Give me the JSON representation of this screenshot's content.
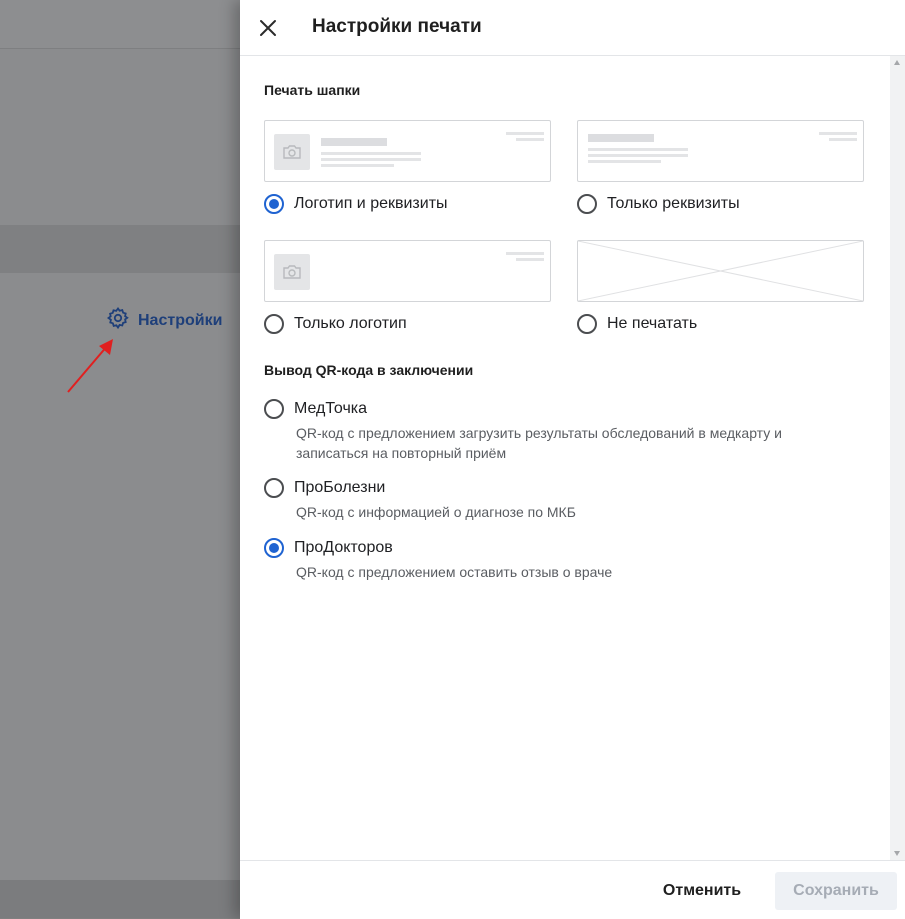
{
  "background": {
    "settings_label": "Настройки"
  },
  "drawer": {
    "title": "Настройки печати",
    "header_section": {
      "title": "Печать шапки",
      "options": [
        {
          "label": "Логотип и реквизиты",
          "checked": true
        },
        {
          "label": "Только реквизиты",
          "checked": false
        },
        {
          "label": "Только логотип",
          "checked": false
        },
        {
          "label": "Не печатать",
          "checked": false
        }
      ]
    },
    "qr_section": {
      "title": "Вывод QR-кода в заключении",
      "options": [
        {
          "label": "МедТочка",
          "description": "QR-код с предложением загрузить результаты обследований в медкарту и записаться на повторный приём",
          "checked": false
        },
        {
          "label": "ПроБолезни",
          "description": "QR-код с информацией о диагнозе по МКБ",
          "checked": false
        },
        {
          "label": "ПроДокторов",
          "description": "QR-код с предложением оставить отзыв о враче",
          "checked": true
        }
      ]
    },
    "footer": {
      "cancel_label": "Отменить",
      "save_label": "Сохранить"
    }
  },
  "colors": {
    "accent": "#1f63d1",
    "settings_link": "#1e3f7a",
    "save_disabled_bg": "#eef1f5",
    "annotation_arrow": "#e02020"
  },
  "icons": [
    "close-icon",
    "gear-icon",
    "camera-icon"
  ]
}
